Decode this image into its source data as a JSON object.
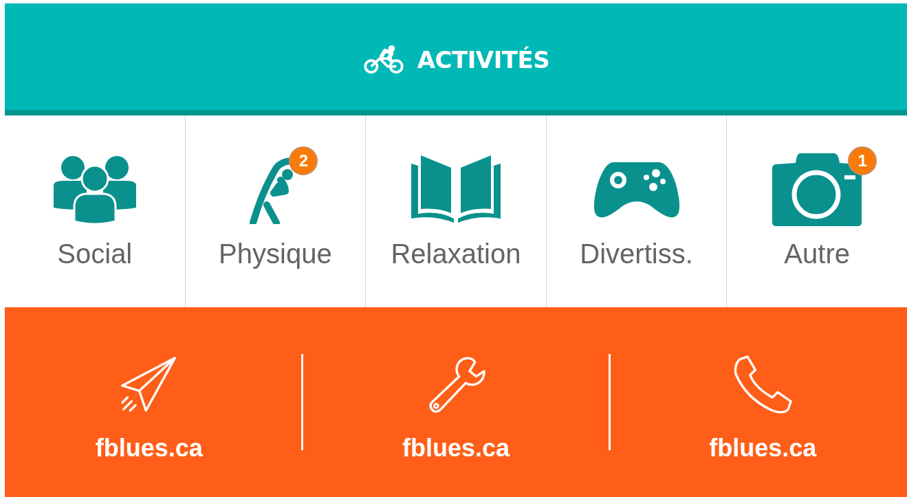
{
  "header": {
    "title": "ACTIVITÉS"
  },
  "categories": [
    {
      "kind": "people",
      "label": "Social"
    },
    {
      "kind": "exercise",
      "label": "Physique",
      "badge": "2"
    },
    {
      "kind": "book",
      "label": "Relaxation"
    },
    {
      "kind": "gamepad",
      "label": "Divertiss."
    },
    {
      "kind": "camera",
      "label": "Autre",
      "badge": "1"
    }
  ],
  "footer": [
    {
      "kind": "send",
      "label": "fblues.ca"
    },
    {
      "kind": "wrench",
      "label": "fblues.ca"
    },
    {
      "kind": "phone",
      "label": "fblues.ca"
    }
  ]
}
